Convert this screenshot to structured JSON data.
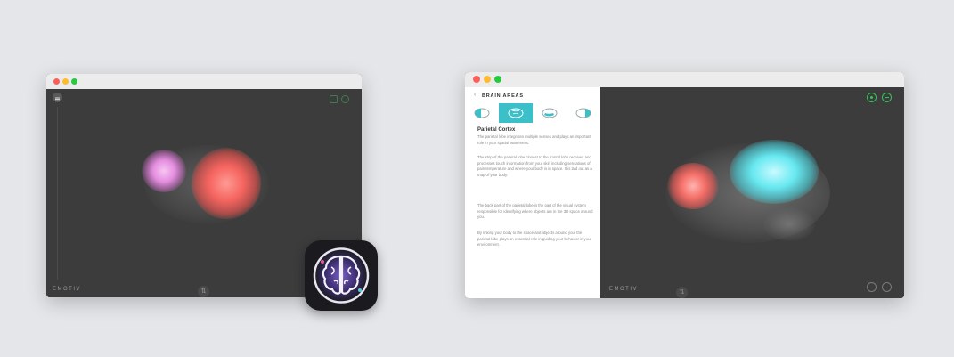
{
  "colors": {
    "background": "#e4e6e9",
    "canvas": "#3c3c3c",
    "accent_teal": "#3bc0c9",
    "active_green": "#35c25b",
    "dot_red": "#ff5f57",
    "dot_yellow": "#febc2e",
    "dot_green": "#28c840"
  },
  "left_window": {
    "brand": "EMOTIV",
    "menu_icon": "menu-icon",
    "top_right_icons": [
      "record-icon",
      "settings-icon"
    ]
  },
  "app_icon": {
    "icon": "brain-app-icon"
  },
  "right_window": {
    "panel": {
      "header": "BRAIN AREAS",
      "back_icon": "chevron-left-icon",
      "tabs": [
        {
          "icon": "frontal-lobe-icon",
          "active": false
        },
        {
          "icon": "parietal-lobe-icon",
          "active": true
        },
        {
          "icon": "temporal-lobe-icon",
          "active": false
        },
        {
          "icon": "occipital-lobe-icon",
          "active": false
        }
      ],
      "title": "Parietal Cortex",
      "paragraphs": [
        "The parietal lobe integrates multiple senses and plays an important role in your spatial awareness.",
        "The strip of the parietal lobe closest to the frontal lobe receives and processes touch information from your skin including sensations of pain temperature and where your body is in space. It is laid out as a map of your body.",
        "The back part of the parietal lobe is the part of the visual system responsible for identifying where objects are in the 3D space around you.",
        "By linking your body to the space and objects around you, the parietal lobe plays an essential role in guiding your behavior in your environment."
      ]
    },
    "brand": "EMOTIV",
    "top_right_icons": [
      "record-icon",
      "settings-icon"
    ],
    "bottom_right_icons": [
      "view-icon",
      "layout-icon"
    ]
  }
}
